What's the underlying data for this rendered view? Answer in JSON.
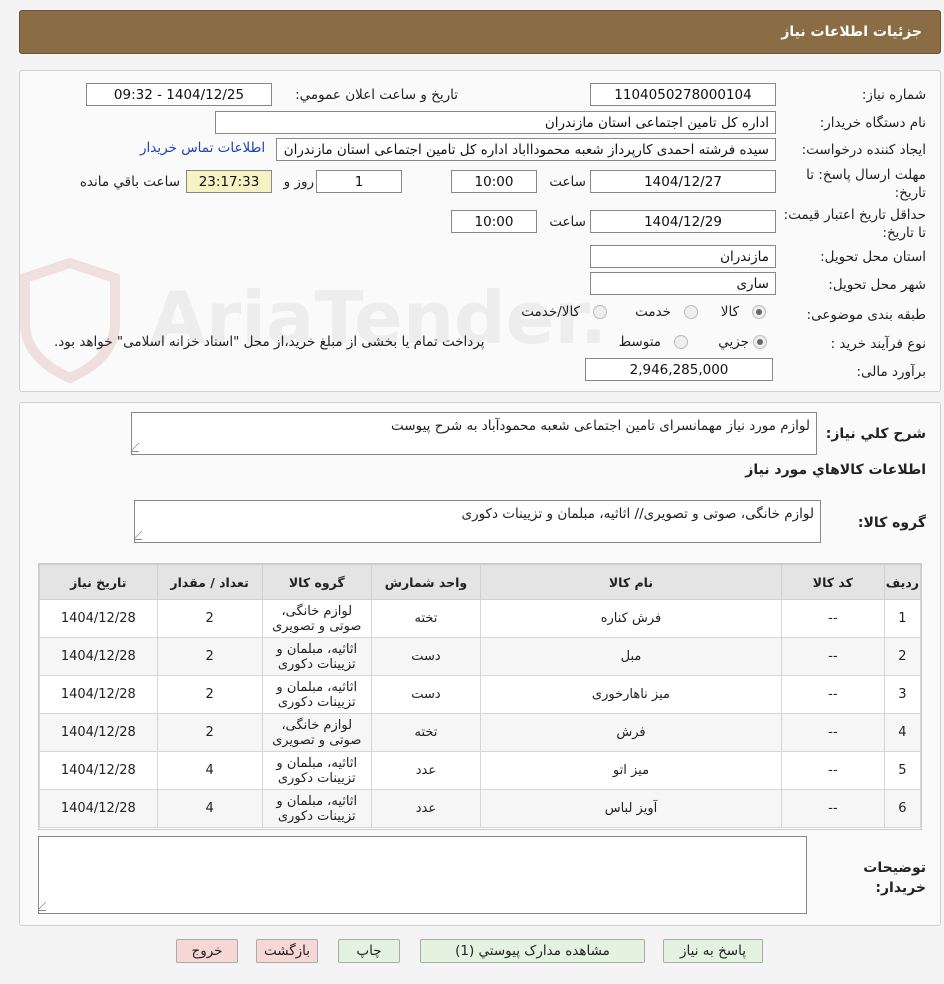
{
  "header": {
    "title": "جزئیات اطلاعات نیاز"
  },
  "form": {
    "need_number_label": "شماره نیاز:",
    "need_number": "1104050278000104",
    "announce_label": "تاریخ و ساعت اعلان عمومي:",
    "announce_value": "1404/12/25 - 09:32",
    "buyer_org_label": "نام دستگاه خریدار:",
    "buyer_org": "اداره کل تامین اجتماعی استان مازندران",
    "requester_label": "ایجاد کننده درخواست:",
    "requester": "سیده فرشته احمدی کارپرداز شعبه محمودااباد اداره کل تامین اجتماعی استان مازندران",
    "contact_link": "اطلاعات تماس خریدار",
    "deadline_label": "مهلت ارسال پاسخ: تا تاریخ:",
    "deadline_date": "1404/12/27",
    "time_label": "ساعت",
    "deadline_time": "10:00",
    "days_value": "1",
    "days_label": "روز و",
    "remaining_time": "23:17:33",
    "remaining_label": "ساعت باقي مانده",
    "validity_label": "حداقل تاریخ اعتبار قیمت: تا تاریخ:",
    "validity_date": "1404/12/29",
    "validity_time": "10:00",
    "province_label": "استان محل تحویل:",
    "province": "مازندران",
    "city_label": "شهر محل تحویل:",
    "city": "ساری",
    "category_label": "طبقه بندی موضوعی:",
    "category_options": [
      "کالا",
      "خدمت",
      "کالا/خدمت"
    ],
    "process_label": "نوع فرآیند خرید :",
    "process_options": [
      "جزیي",
      "متوسط"
    ],
    "process_note": "پرداخت تمام یا بخشی از مبلغ خرید،از محل \"اسناد خزانه اسلامی\" خواهد بود.",
    "budget_label": "برآورد مالی:",
    "budget": "2,946,285,000"
  },
  "summary": {
    "label": "شرح کلي نیاز:",
    "text": "لوازم مورد نیاز مهمانسرای تامین اجتماعی شعبه محمودآباد به شرح پیوست",
    "items_title": "اطلاعات کالاهاي مورد نیاز",
    "group_label": "گروه کالا:",
    "group_text": "لوازم خانگی، صوتی و تصویری// اثاثیه، مبلمان و تزیینات دکوری"
  },
  "table": {
    "headers": [
      "ردیف",
      "کد کالا",
      "نام کالا",
      "واحد شمارش",
      "گروه کالا",
      "تعداد / مقدار",
      "تاریخ نیاز"
    ],
    "rows": [
      [
        "1",
        "--",
        "فرش کناره",
        "تخته",
        "لوازم خانگی، صوتی و تصویری",
        "2",
        "1404/12/28"
      ],
      [
        "2",
        "--",
        "مبل",
        "دست",
        "اثاثیه، مبلمان و تزیینات دکوری",
        "2",
        "1404/12/28"
      ],
      [
        "3",
        "--",
        "میز ناهارخوری",
        "دست",
        "اثاثیه، مبلمان و تزیینات دکوری",
        "2",
        "1404/12/28"
      ],
      [
        "4",
        "--",
        "فرش",
        "تخته",
        "لوازم خانگی، صوتی و تصویری",
        "2",
        "1404/12/28"
      ],
      [
        "5",
        "--",
        "میز اتو",
        "عدد",
        "اثاثیه، مبلمان و تزیینات دکوری",
        "4",
        "1404/12/28"
      ],
      [
        "6",
        "--",
        "آویز لباس",
        "عدد",
        "اثاثیه، مبلمان و تزیینات دکوری",
        "4",
        "1404/12/28"
      ]
    ]
  },
  "notes": {
    "label": "توضیحات خریدار:"
  },
  "buttons": {
    "reply": "پاسخ به نیاز",
    "attachments": "مشاهده مدارک پیوستي (1)",
    "print": "چاپ",
    "back": "بازگشت",
    "exit": "خروج"
  },
  "watermark": {
    "text": "AriaTender.neT"
  },
  "colors": {
    "header_bg": "#8b6d45",
    "link": "#1d43b5",
    "time_bg": "#f6f2c4",
    "btn_green": "#e3f3e0",
    "btn_pink": "#f7d6d6"
  }
}
